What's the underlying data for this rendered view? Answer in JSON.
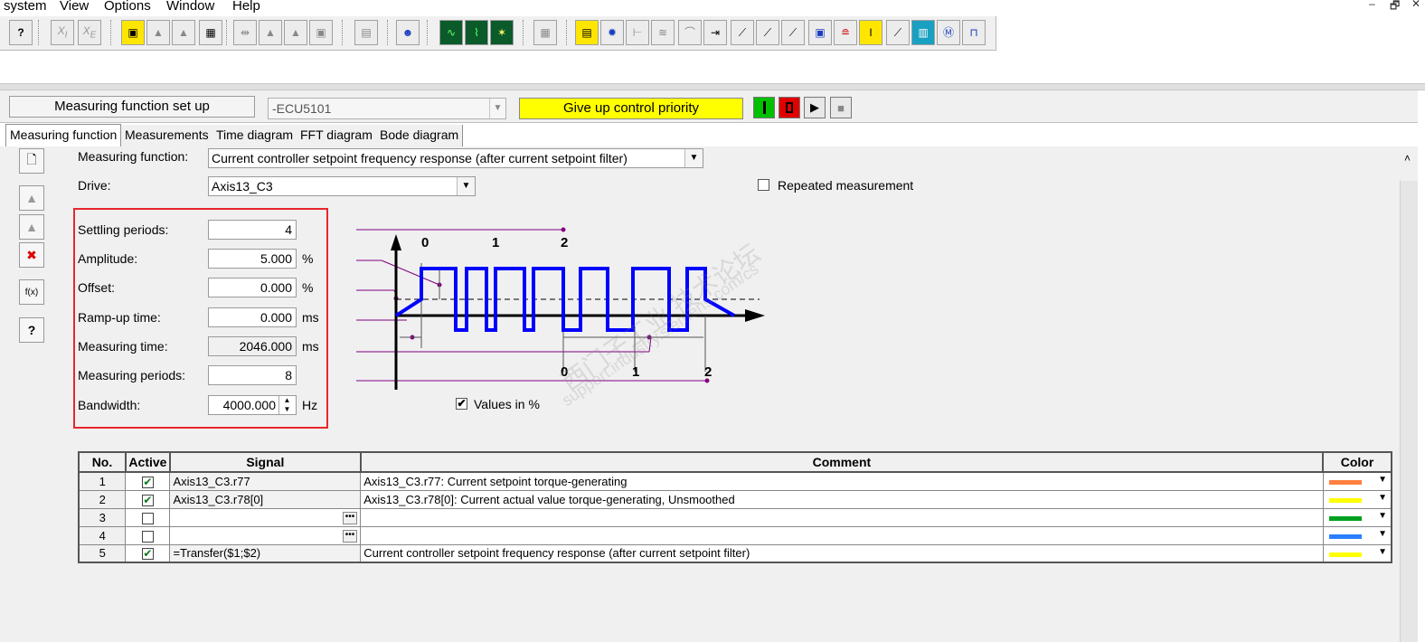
{
  "menu": [
    "system",
    "View",
    "Options",
    "Window",
    "Help"
  ],
  "window_controls": [
    "–",
    "🗗",
    "✕"
  ],
  "header": {
    "title_box": "Measuring function set up",
    "ecu": "-ECU5101",
    "give_up_button": "Give up control priority"
  },
  "tabs": [
    "Measuring function",
    "Measurements",
    "Time diagram",
    "FFT diagram",
    "Bode diagram"
  ],
  "form": {
    "measuring_function_label": "Measuring function:",
    "measuring_function_value": "Current controller setpoint frequency response (after current setpoint filter)",
    "drive_label": "Drive:",
    "drive_value": "Axis13_C3",
    "repeated_label": "Repeated measurement",
    "settling_label": "Settling periods:",
    "settling_value": "4",
    "amplitude_label": "Amplitude:",
    "amplitude_value": "5.000",
    "amplitude_unit": "%",
    "offset_label": "Offset:",
    "offset_value": "0.000",
    "offset_unit": "%",
    "rampup_label": "Ramp-up time:",
    "rampup_value": "0.000",
    "rampup_unit": "ms",
    "meas_time_label": "Measuring time:",
    "meas_time_value": "2046.000",
    "meas_time_unit": "ms",
    "meas_periods_label": "Measuring periods:",
    "meas_periods_value": "8",
    "bandwidth_label": "Bandwidth:",
    "bandwidth_value": "4000.000",
    "bandwidth_unit": "Hz",
    "values_in_pct_label": "Values in %"
  },
  "diagram": {
    "top_ticks": [
      "0",
      "1",
      "2"
    ],
    "bottom_ticks": [
      "0",
      "1",
      "2"
    ]
  },
  "watermark": {
    "line1": "西门子工业 技术论坛",
    "line2": "support.industry.siemens.com/cs"
  },
  "table": {
    "headers": [
      "No.",
      "Active",
      "Signal",
      "Comment",
      "Color"
    ],
    "rows": [
      {
        "no": "1",
        "active": "✔",
        "signal": "Axis13_C3.r77",
        "comment": "Axis13_C3.r77: Current setpoint torque-generating"
      },
      {
        "no": "2",
        "active": "✔",
        "signal": "Axis13_C3.r78[0]",
        "comment": "Axis13_C3.r78[0]: Current actual value torque-generating, Unsmoothed"
      },
      {
        "no": "3",
        "active": "",
        "signal": "",
        "comment": ""
      },
      {
        "no": "4",
        "active": "",
        "signal": "",
        "comment": ""
      },
      {
        "no": "5",
        "active": "✔",
        "signal": "=Transfer($1;$2)",
        "comment": "Current controller setpoint frequency response (after current setpoint filter)"
      }
    ],
    "row_colors": [
      "#ff7f3f",
      "#ffff00",
      "#00a020",
      "#2a7fff",
      "#ffff00"
    ]
  },
  "colors": {
    "give_up_bg": "#ffff00",
    "highlight_box": "#e8262c",
    "signal_blue": "#0000ff",
    "marker_purple": "#800080"
  }
}
